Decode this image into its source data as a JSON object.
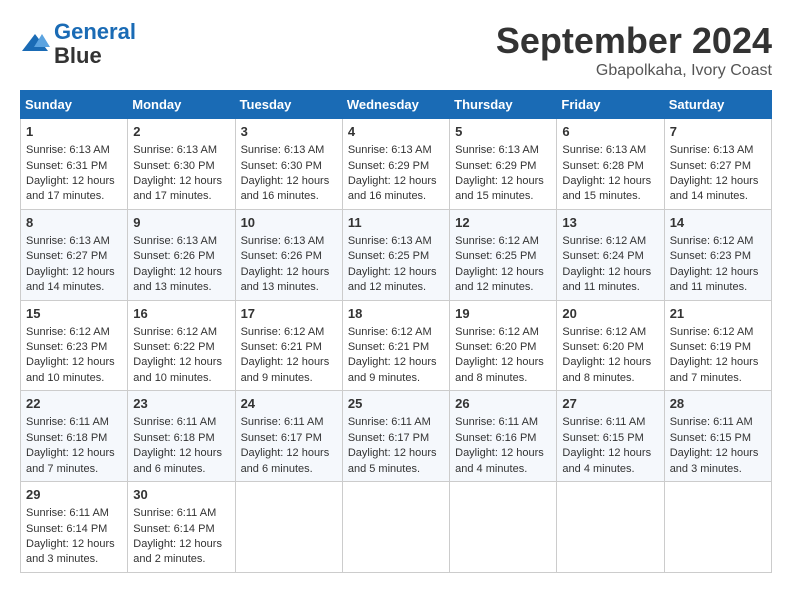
{
  "header": {
    "logo_line1": "General",
    "logo_line2": "Blue",
    "month": "September 2024",
    "location": "Gbapolkaha, Ivory Coast"
  },
  "days_of_week": [
    "Sunday",
    "Monday",
    "Tuesday",
    "Wednesday",
    "Thursday",
    "Friday",
    "Saturday"
  ],
  "weeks": [
    [
      {
        "day": 1,
        "sunrise": "6:13 AM",
        "sunset": "6:31 PM",
        "daylight": "12 hours and 17 minutes."
      },
      {
        "day": 2,
        "sunrise": "6:13 AM",
        "sunset": "6:30 PM",
        "daylight": "12 hours and 17 minutes."
      },
      {
        "day": 3,
        "sunrise": "6:13 AM",
        "sunset": "6:30 PM",
        "daylight": "12 hours and 16 minutes."
      },
      {
        "day": 4,
        "sunrise": "6:13 AM",
        "sunset": "6:29 PM",
        "daylight": "12 hours and 16 minutes."
      },
      {
        "day": 5,
        "sunrise": "6:13 AM",
        "sunset": "6:29 PM",
        "daylight": "12 hours and 15 minutes."
      },
      {
        "day": 6,
        "sunrise": "6:13 AM",
        "sunset": "6:28 PM",
        "daylight": "12 hours and 15 minutes."
      },
      {
        "day": 7,
        "sunrise": "6:13 AM",
        "sunset": "6:27 PM",
        "daylight": "12 hours and 14 minutes."
      }
    ],
    [
      {
        "day": 8,
        "sunrise": "6:13 AM",
        "sunset": "6:27 PM",
        "daylight": "12 hours and 14 minutes."
      },
      {
        "day": 9,
        "sunrise": "6:13 AM",
        "sunset": "6:26 PM",
        "daylight": "12 hours and 13 minutes."
      },
      {
        "day": 10,
        "sunrise": "6:13 AM",
        "sunset": "6:26 PM",
        "daylight": "12 hours and 13 minutes."
      },
      {
        "day": 11,
        "sunrise": "6:13 AM",
        "sunset": "6:25 PM",
        "daylight": "12 hours and 12 minutes."
      },
      {
        "day": 12,
        "sunrise": "6:12 AM",
        "sunset": "6:25 PM",
        "daylight": "12 hours and 12 minutes."
      },
      {
        "day": 13,
        "sunrise": "6:12 AM",
        "sunset": "6:24 PM",
        "daylight": "12 hours and 11 minutes."
      },
      {
        "day": 14,
        "sunrise": "6:12 AM",
        "sunset": "6:23 PM",
        "daylight": "12 hours and 11 minutes."
      }
    ],
    [
      {
        "day": 15,
        "sunrise": "6:12 AM",
        "sunset": "6:23 PM",
        "daylight": "12 hours and 10 minutes."
      },
      {
        "day": 16,
        "sunrise": "6:12 AM",
        "sunset": "6:22 PM",
        "daylight": "12 hours and 10 minutes."
      },
      {
        "day": 17,
        "sunrise": "6:12 AM",
        "sunset": "6:21 PM",
        "daylight": "12 hours and 9 minutes."
      },
      {
        "day": 18,
        "sunrise": "6:12 AM",
        "sunset": "6:21 PM",
        "daylight": "12 hours and 9 minutes."
      },
      {
        "day": 19,
        "sunrise": "6:12 AM",
        "sunset": "6:20 PM",
        "daylight": "12 hours and 8 minutes."
      },
      {
        "day": 20,
        "sunrise": "6:12 AM",
        "sunset": "6:20 PM",
        "daylight": "12 hours and 8 minutes."
      },
      {
        "day": 21,
        "sunrise": "6:12 AM",
        "sunset": "6:19 PM",
        "daylight": "12 hours and 7 minutes."
      }
    ],
    [
      {
        "day": 22,
        "sunrise": "6:11 AM",
        "sunset": "6:18 PM",
        "daylight": "12 hours and 7 minutes."
      },
      {
        "day": 23,
        "sunrise": "6:11 AM",
        "sunset": "6:18 PM",
        "daylight": "12 hours and 6 minutes."
      },
      {
        "day": 24,
        "sunrise": "6:11 AM",
        "sunset": "6:17 PM",
        "daylight": "12 hours and 6 minutes."
      },
      {
        "day": 25,
        "sunrise": "6:11 AM",
        "sunset": "6:17 PM",
        "daylight": "12 hours and 5 minutes."
      },
      {
        "day": 26,
        "sunrise": "6:11 AM",
        "sunset": "6:16 PM",
        "daylight": "12 hours and 4 minutes."
      },
      {
        "day": 27,
        "sunrise": "6:11 AM",
        "sunset": "6:15 PM",
        "daylight": "12 hours and 4 minutes."
      },
      {
        "day": 28,
        "sunrise": "6:11 AM",
        "sunset": "6:15 PM",
        "daylight": "12 hours and 3 minutes."
      }
    ],
    [
      {
        "day": 29,
        "sunrise": "6:11 AM",
        "sunset": "6:14 PM",
        "daylight": "12 hours and 3 minutes."
      },
      {
        "day": 30,
        "sunrise": "6:11 AM",
        "sunset": "6:14 PM",
        "daylight": "12 hours and 2 minutes."
      },
      null,
      null,
      null,
      null,
      null
    ]
  ],
  "labels": {
    "sunrise": "Sunrise:",
    "sunset": "Sunset:",
    "daylight": "Daylight:"
  }
}
